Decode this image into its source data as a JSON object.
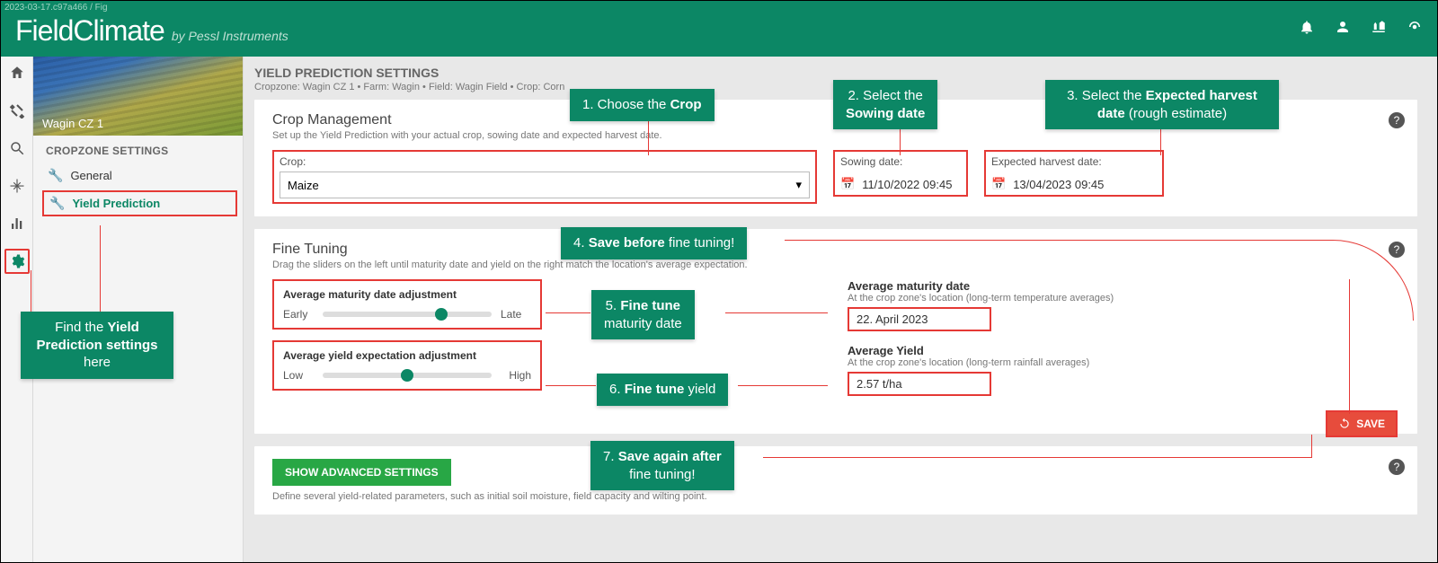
{
  "version": "2023-03-17.c97a466 / Fig",
  "brand": {
    "main": "FieldClimate",
    "sub": "by Pessl Instruments"
  },
  "cropzone_caption": "Wagin CZ 1",
  "sidebar": {
    "title": "CROPZONE SETTINGS",
    "general": "General",
    "yield": "Yield Prediction"
  },
  "page": {
    "title": "YIELD PREDICTION SETTINGS",
    "breadcrumb": "Cropzone: Wagin CZ 1 • Farm: Wagin • Field: Wagin Field • Crop: Corn"
  },
  "crop_mgmt": {
    "title": "Crop Management",
    "sub": "Set up the Yield Prediction with your actual crop, sowing date and expected harvest date.",
    "crop_label": "Crop:",
    "crop_value": "Maize",
    "sowing_label": "Sowing date:",
    "sowing_value": "11/10/2022 09:45",
    "harvest_label": "Expected harvest date:",
    "harvest_value": "13/04/2023 09:45"
  },
  "fine": {
    "title": "Fine Tuning",
    "sub": "Drag the sliders on the left until maturity date and yield on the right match the location's average expectation.",
    "mat_label": "Average maturity date adjustment",
    "mat_low": "Early",
    "mat_high": "Late",
    "yld_label": "Average yield expectation adjustment",
    "yld_low": "Low",
    "yld_high": "High",
    "avg_mat_title": "Average maturity date",
    "avg_mat_sub": "At the crop zone's location (long-term temperature averages)",
    "avg_mat_val": "22. April 2023",
    "avg_yld_title": "Average Yield",
    "avg_yld_sub": "At the crop zone's location (long-term rainfall averages)",
    "avg_yld_val": "2.57 t/ha",
    "save": "SAVE"
  },
  "adv": {
    "btn": "SHOW ADVANCED SETTINGS",
    "sub": "Define several yield-related parameters, such as initial soil moisture, field capacity and wilting point."
  },
  "callouts": {
    "find_a": "Find the ",
    "find_b": "Yield Prediction settings",
    "find_c": " here",
    "c1a": "1. Choose the ",
    "c1b": "Crop",
    "c2a": "2. Select the ",
    "c2b": "Sowing date",
    "c3a": "3. Select the ",
    "c3b": "Expected harvest date",
    "c3c": " (rough estimate)",
    "c4a": "4. ",
    "c4b": "Save before",
    "c4c": " fine tuning!",
    "c5a": "5. ",
    "c5b": "Fine tune",
    "c5c": " maturity date",
    "c6a": "6. ",
    "c6b": "Fine tune",
    "c6c": " yield",
    "c7a": "7. ",
    "c7b": "Save again after",
    "c7c": " fine tuning!"
  }
}
